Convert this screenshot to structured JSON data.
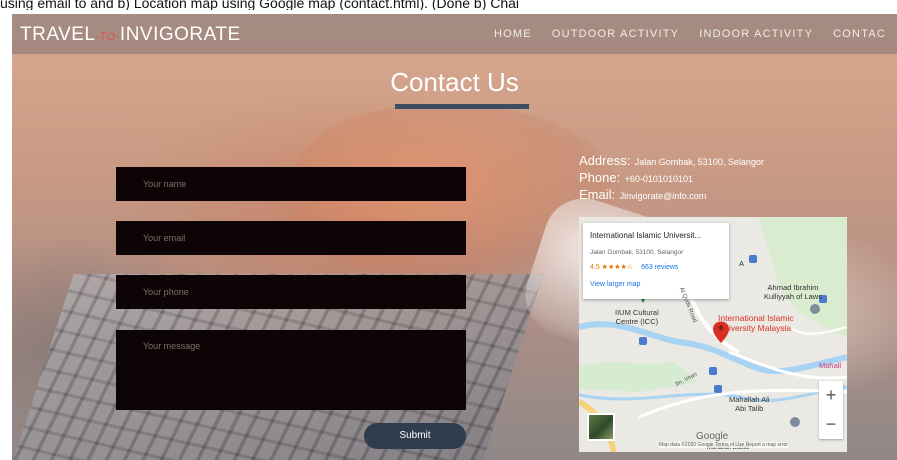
{
  "doc_caption": "using email to and b) Location map using Google map (contact.html). (Done b) Chai",
  "navbar": {
    "logo_left": "TRAVEL",
    "logo_mid": "-TO-",
    "logo_right": "INVIGORATE",
    "links": [
      "HOME",
      "OUTDOOR ACTIVITY",
      "INDOOR ACTIVITY",
      "CONTAC"
    ]
  },
  "page_title": "Contact Us",
  "form": {
    "name_placeholder": "Your name",
    "email_placeholder": "Your email",
    "phone_placeholder": "Your phone",
    "message_placeholder": "Your message",
    "submit_label": "Submit"
  },
  "contact_info": {
    "address_label": "Address:",
    "address_value": "Jalan Gombak, 53100, Selangor",
    "phone_label": "Phone:",
    "phone_value": "+60-0101010101",
    "email_label": "Email:",
    "email_value": "Jinvigorate@info.com"
  },
  "map": {
    "card_name": "International Islamic Universit...",
    "card_address": "Jalan Gombak, 53100, Selangor",
    "card_rating": "4.5 ★★★★☆",
    "card_reviews": "663 reviews",
    "card_link": "View larger map",
    "label_iium_cultural": "IIUM Cultural\nCentre (ICC)",
    "label_ahmad_ibrahim": "Ahmad Ibrahim\nKulliyyah of Laws",
    "label_university": "International Islamic\nUniversity Malaysia",
    "label_mahallah_ali": "Mahallah Ali\nAbi Talib",
    "label_mahalla_edge": "Mahall",
    "label_mahallah_zubair": "Mahallah Zubair",
    "label_road": "Al Quds Road",
    "label_jalan": "Jln. Iman",
    "label_marker_a": "A",
    "label_google": "Google",
    "attribution": "Map data ©2020 Google   Terms of Use   Report a map error",
    "zoom_in": "+",
    "zoom_out": "−",
    "colors": {
      "pin": "#d93025",
      "link": "#1a73e8",
      "marker": "#4a7bd1"
    }
  }
}
